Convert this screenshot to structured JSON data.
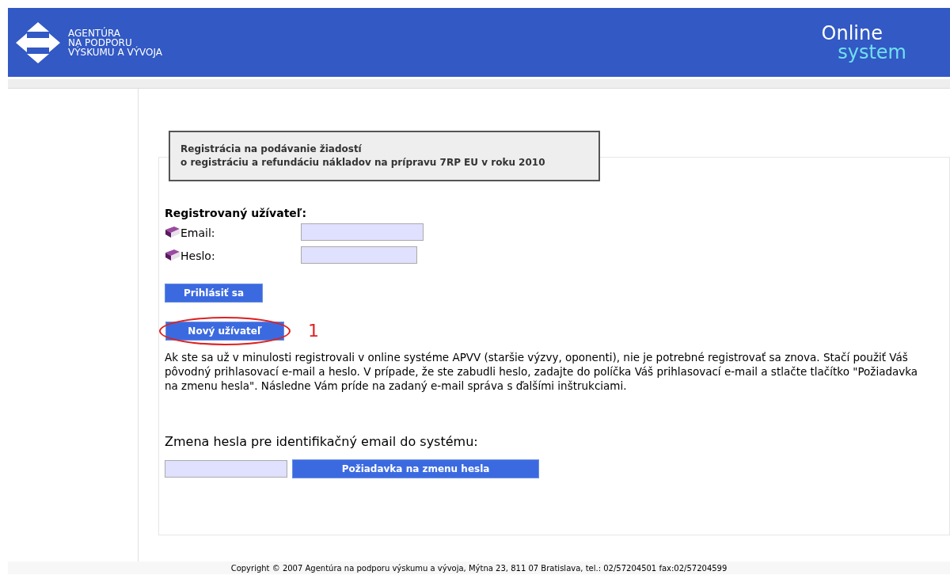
{
  "header": {
    "logo_lines": [
      "AGENTÚRA",
      "NA PODPORU",
      "VÝSKUMU A VÝVOJA"
    ],
    "brand_line_1": "Online",
    "brand_line_2": "system"
  },
  "title_box": {
    "lines": [
      "Registrácia na podávanie žiadostí",
      "o registráciu a refundáciu nákladov na prípravu 7RP EU v roku 2010"
    ]
  },
  "login": {
    "heading": "Registrovaný užívateľ:",
    "fields": [
      {
        "label": "Email:"
      },
      {
        "label": "Heslo:"
      }
    ],
    "login_button": "Prihlásiť sa",
    "new_user_button": "Nový užívateľ",
    "annotation": "1"
  },
  "info_text": "Ak ste sa už v minulosti registrovali v online systéme APVV (staršie výzvy, oponenti), nie je potrebné registrovať sa znova. Stačí použiť Váš pôvodný prihlasovací e-mail a heslo. V prípade, že ste zabudli heslo, zadajte do políčka Váš prihlasovací e-mail a stlačte tlačítko \"Požiadavka na zmenu hesla\". Následne Vám príde na zadaný e-mail správa s ďalšími inštrukciami.",
  "password_reset": {
    "heading": "Zmena hesla pre identifikačný email do systému:",
    "button": "Požiadavka na zmenu hesla"
  },
  "footer": "Copyright © 2007 Agentúra na podporu výskumu a vývoja, Mýtna 23, 811 07 Bratislava, tel.: 02/57204501 fax:02/57204599"
}
